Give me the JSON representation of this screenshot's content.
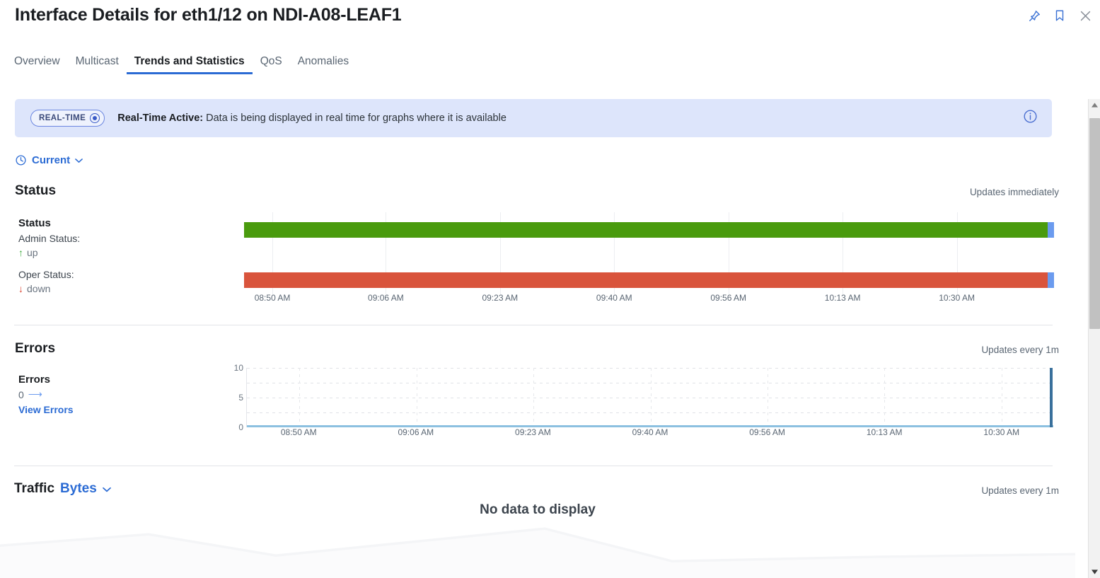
{
  "header": {
    "title": "Interface Details for eth1/12 on NDI-A08-LEAF1",
    "icons": [
      {
        "name": "pin-icon",
        "label": "Pin"
      },
      {
        "name": "bookmark-icon",
        "label": "Bookmark"
      },
      {
        "name": "close-icon",
        "label": "Close"
      }
    ]
  },
  "tabs": [
    {
      "label": "Overview",
      "active": false
    },
    {
      "label": "Multicast",
      "active": false
    },
    {
      "label": "Trends and Statistics",
      "active": true
    },
    {
      "label": "QoS",
      "active": false
    },
    {
      "label": "Anomalies",
      "active": false
    }
  ],
  "banner": {
    "pill_label": "REAL-TIME",
    "title": "Real-Time Active:",
    "message": "Data is being displayed in real time for graphs where it is available",
    "info_icon": "info-circle-icon",
    "bg_color": "#dde5fb"
  },
  "time_selector": {
    "icon": "clock-icon",
    "label": "Current",
    "chevron": "⌄"
  },
  "sections": {
    "status": {
      "title": "Status",
      "updates": "Updates immediately",
      "legend_title": "Status",
      "admin_label": "Admin Status:",
      "admin_value": "up",
      "admin_arrow": "↑",
      "admin_color": "#3ca93c",
      "oper_label": "Oper Status:",
      "oper_value": "down",
      "oper_arrow": "↓",
      "oper_color": "#d9402c"
    },
    "errors": {
      "title": "Errors",
      "updates": "Updates every 1m",
      "legend_title": "Errors",
      "value": "0",
      "value_arrow": "⟶",
      "link_label": "View Errors"
    },
    "traffic": {
      "title": "Traffic",
      "unit_label": "Bytes",
      "chevron": "⌄",
      "updates": "Updates every 1m",
      "no_data": "No data to display"
    }
  },
  "chart_data": [
    {
      "type": "bar",
      "title": "Status",
      "chart_name": "status-timeline",
      "xlabel": "",
      "ylabel": "",
      "x_tick_labels": [
        "08:50 AM",
        "09:06 AM",
        "09:23 AM",
        "09:40 AM",
        "09:56 AM",
        "10:13 AM",
        "10:30 AM"
      ],
      "x_tick_positions_pct": [
        3.5,
        17.5,
        31.6,
        45.7,
        59.8,
        73.9,
        88.0
      ],
      "grid": true,
      "legend_position": "left",
      "series": [
        {
          "name": "Admin Status",
          "state": "up",
          "color": "#4a9b0e",
          "coverage_pct": 100,
          "end_marker_color": "#6b9bef",
          "end_marker_pct": 0.8
        },
        {
          "name": "Oper Status",
          "state": "down",
          "color": "#d9543c",
          "coverage_pct": 100,
          "end_marker_color": "#6b9bef",
          "end_marker_pct": 0.8
        }
      ]
    },
    {
      "type": "line",
      "title": "Errors",
      "chart_name": "errors-timeseries",
      "xlabel": "",
      "ylabel": "",
      "ylim": [
        0,
        10
      ],
      "y_tick_labels": [
        "10",
        "5",
        "0"
      ],
      "y_tick_values": [
        10,
        5,
        0
      ],
      "x_tick_labels": [
        "08:50 AM",
        "09:06 AM",
        "09:23 AM",
        "09:40 AM",
        "09:56 AM",
        "10:13 AM",
        "10:30 AM"
      ],
      "x_tick_positions_pct": [
        6.5,
        21.0,
        35.5,
        50.0,
        64.5,
        79.0,
        93.5
      ],
      "grid": true,
      "legend_position": "left",
      "series": [
        {
          "name": "Errors",
          "color": "#8cc0e0",
          "values": [
            0,
            0,
            0,
            0,
            0,
            0,
            0
          ],
          "current_value": 0
        },
        {
          "name": "Current marker",
          "color": "#39709c",
          "type": "vline",
          "x_pct": 99.5,
          "y_range": [
            0,
            10
          ]
        }
      ]
    },
    {
      "type": "area",
      "title": "Traffic",
      "chart_name": "traffic-placeholder",
      "state": "no-data",
      "message": "No data to display",
      "series": []
    }
  ],
  "scrollbar": {
    "up_arrow": "▲",
    "down_arrow": "▼",
    "thumb_top_pct": 1.5,
    "thumb_height_pct": 44
  }
}
